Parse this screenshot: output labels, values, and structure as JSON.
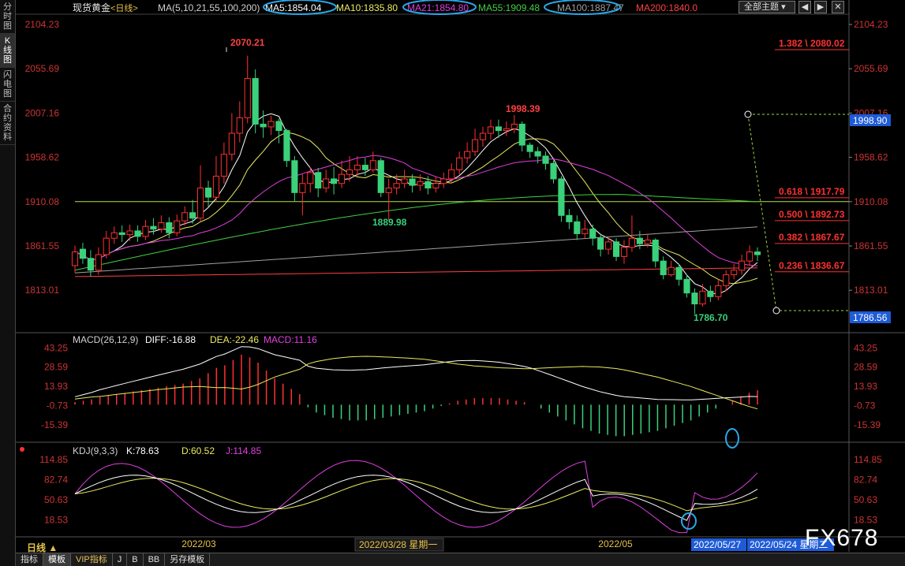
{
  "app": {
    "title": "现货黄金",
    "period_tag": "<日线>",
    "period_label": "日线 ▲",
    "watermark": "FX678",
    "theme_button": "全部主题",
    "theme_icon": "chevron-down-icon",
    "ctl_left": "◀",
    "ctl_right": "▶",
    "ctl_close": "✕"
  },
  "sidetabs": [
    {
      "label": "分时图"
    },
    {
      "label": "K线图",
      "active": true
    },
    {
      "label": "闪电图"
    },
    {
      "label": "合约资料"
    }
  ],
  "bottomtabs": [
    {
      "label": "指标"
    },
    {
      "label": "模板",
      "active": true
    },
    {
      "label": "VIP指标",
      "vip": true
    },
    {
      "label": "J"
    },
    {
      "label": "B"
    },
    {
      "label": "BB"
    },
    {
      "label": "另存模板"
    }
  ],
  "main": {
    "legend": [
      {
        "text": "MA(5,10,21,55,100,200)",
        "color": "#d0d0d0"
      },
      {
        "text": "MA5:1854.04",
        "color": "#ffffff"
      },
      {
        "text": "MA10:1835.80",
        "color": "#eaea60"
      },
      {
        "text": "MA21:1854.80",
        "color": "#e040e0"
      },
      {
        "text": "MA55:1909.48",
        "color": "#40d040"
      },
      {
        "text": "MA100:1887.47",
        "color": "#a0a0a0"
      },
      {
        "text": "MA200:1840.0",
        "color": "#ff4040"
      }
    ],
    "yticks": [
      "2104.23",
      "2055.69",
      "2007.16",
      "1958.62",
      "1910.08",
      "1861.55",
      "1813.01"
    ],
    "ymin": 1770,
    "ymax": 2112,
    "price_tags": [
      {
        "text": "1998.90",
        "value": 1998.9
      },
      {
        "text": "1786.56",
        "value": 1786.56
      }
    ],
    "annotations": [
      {
        "text": "2070.21",
        "value": 2070.21
      },
      {
        "text": "1998.39",
        "value": 1998.39
      },
      {
        "text": "1889.98",
        "value": 1889.98
      },
      {
        "text": "1786.70",
        "value": 1786.7
      }
    ],
    "fib": [
      {
        "text": "1.382 \\ 2080.02",
        "value": 2080.02
      },
      {
        "text": "0.618 \\ 1917.79",
        "value": 1917.79
      },
      {
        "text": "0.500 \\ 1892.73",
        "value": 1892.73
      },
      {
        "text": "0.382 \\ 1867.67",
        "value": 1867.67
      },
      {
        "text": "0.236 \\ 1836.67",
        "value": 1836.67
      }
    ],
    "hline": 1910.08
  },
  "macd": {
    "legend": [
      {
        "text": "MACD(26,12,9)",
        "color": "#d0d0d0"
      },
      {
        "text": "DIFF:-16.88",
        "color": "#ffffff"
      },
      {
        "text": "DEA:-22.46",
        "color": "#eaea60"
      },
      {
        "text": "MACD:11.16",
        "color": "#e040e0"
      }
    ],
    "yticks": [
      "43.25",
      "28.59",
      "13.93",
      "-0.73",
      "-15.39"
    ],
    "ymin": -25,
    "ymax": 47
  },
  "kdj": {
    "legend": [
      {
        "text": "KDJ(9,3,3)",
        "color": "#d0d0d0"
      },
      {
        "text": "K:78.63",
        "color": "#ffffff"
      },
      {
        "text": "D:60.52",
        "color": "#eaea60"
      },
      {
        "text": "J:114.85",
        "color": "#e040e0"
      }
    ],
    "yticks": [
      "114.85",
      "82.74",
      "50.63",
      "18.53"
    ],
    "ymin": -5,
    "ymax": 125
  },
  "xaxis": {
    "labels": [
      "2022/03",
      "2022/03/28 星期一",
      "2022/05"
    ],
    "cursor_dates": [
      "2022/05/27",
      "2022/05/24 星期二"
    ]
  },
  "chart_data": {
    "type": "candlestick",
    "title": "现货黄金<日线>",
    "x_labels": [
      "2022/03",
      "2022/05"
    ],
    "yrange": [
      1770,
      2112
    ],
    "candles": [
      [
        1840,
        1855,
        1862,
        1832
      ],
      [
        1858,
        1848,
        1865,
        1842
      ],
      [
        1848,
        1835,
        1857,
        1828
      ],
      [
        1835,
        1852,
        1860,
        1830
      ],
      [
        1852,
        1870,
        1878,
        1848
      ],
      [
        1870,
        1876,
        1883,
        1864
      ],
      [
        1876,
        1874,
        1884,
        1866
      ],
      [
        1874,
        1878,
        1885,
        1867
      ],
      [
        1878,
        1872,
        1884,
        1866
      ],
      [
        1872,
        1883,
        1890,
        1868
      ],
      [
        1883,
        1880,
        1892,
        1874
      ],
      [
        1880,
        1887,
        1895,
        1876
      ],
      [
        1887,
        1876,
        1893,
        1870
      ],
      [
        1876,
        1889,
        1896,
        1872
      ],
      [
        1889,
        1898,
        1905,
        1884
      ],
      [
        1898,
        1892,
        1912,
        1886
      ],
      [
        1892,
        1925,
        1950,
        1888
      ],
      [
        1925,
        1915,
        1933,
        1905
      ],
      [
        1915,
        1938,
        1960,
        1910
      ],
      [
        1938,
        1962,
        1975,
        1930
      ],
      [
        1962,
        1985,
        2007,
        1955
      ],
      [
        1985,
        2002,
        2020,
        1975
      ],
      [
        2002,
        2045,
        2070,
        1996
      ],
      [
        2045,
        1995,
        2055,
        1985
      ],
      [
        1995,
        1992,
        2010,
        1980
      ],
      [
        1992,
        1998,
        2004,
        1983
      ],
      [
        1998,
        1988,
        2001,
        1974
      ],
      [
        1988,
        1955,
        1990,
        1948
      ],
      [
        1955,
        1920,
        1960,
        1910
      ],
      [
        1920,
        1930,
        1940,
        1895
      ],
      [
        1930,
        1942,
        1948,
        1920
      ],
      [
        1942,
        1925,
        1947,
        1915
      ],
      [
        1925,
        1935,
        1945,
        1920
      ],
      [
        1935,
        1930,
        1948,
        1918
      ],
      [
        1930,
        1940,
        1955,
        1925
      ],
      [
        1940,
        1945,
        1960,
        1932
      ],
      [
        1945,
        1950,
        1960,
        1938
      ],
      [
        1950,
        1945,
        1958,
        1938
      ],
      [
        1945,
        1955,
        1965,
        1942
      ],
      [
        1955,
        1920,
        1958,
        1915
      ],
      [
        1920,
        1925,
        1935,
        1890
      ],
      [
        1925,
        1930,
        1940,
        1918
      ],
      [
        1930,
        1935,
        1945,
        1925
      ],
      [
        1935,
        1928,
        1940,
        1920
      ],
      [
        1928,
        1932,
        1940,
        1922
      ],
      [
        1932,
        1925,
        1938,
        1918
      ],
      [
        1925,
        1930,
        1938,
        1920
      ],
      [
        1930,
        1935,
        1942,
        1925
      ],
      [
        1935,
        1945,
        1952,
        1930
      ],
      [
        1945,
        1958,
        1965,
        1940
      ],
      [
        1958,
        1965,
        1975,
        1952
      ],
      [
        1965,
        1978,
        1990,
        1960
      ],
      [
        1978,
        1985,
        1992,
        1970
      ],
      [
        1985,
        1992,
        2000,
        1978
      ],
      [
        1992,
        1988,
        2000,
        1980
      ],
      [
        1988,
        1990,
        1998,
        1982
      ],
      [
        1990,
        1995,
        2005,
        1985
      ],
      [
        1995,
        1972,
        1998,
        1965
      ],
      [
        1972,
        1965,
        1975,
        1958
      ],
      [
        1965,
        1960,
        1970,
        1952
      ],
      [
        1960,
        1952,
        1965,
        1945
      ],
      [
        1952,
        1935,
        1955,
        1930
      ],
      [
        1935,
        1895,
        1938,
        1888
      ],
      [
        1895,
        1888,
        1902,
        1880
      ],
      [
        1888,
        1875,
        1895,
        1868
      ],
      [
        1875,
        1880,
        1890,
        1870
      ],
      [
        1880,
        1870,
        1885,
        1862
      ],
      [
        1870,
        1858,
        1875,
        1850
      ],
      [
        1858,
        1866,
        1872,
        1852
      ],
      [
        1866,
        1850,
        1870,
        1845
      ],
      [
        1850,
        1860,
        1868,
        1842
      ],
      [
        1860,
        1870,
        1895,
        1855
      ],
      [
        1870,
        1864,
        1878,
        1858
      ],
      [
        1864,
        1868,
        1875,
        1860
      ],
      [
        1868,
        1845,
        1870,
        1838
      ],
      [
        1845,
        1830,
        1850,
        1825
      ],
      [
        1830,
        1838,
        1845,
        1828
      ],
      [
        1838,
        1825,
        1842,
        1818
      ],
      [
        1825,
        1810,
        1830,
        1805
      ],
      [
        1810,
        1798,
        1815,
        1787
      ],
      [
        1798,
        1812,
        1820,
        1795
      ],
      [
        1812,
        1806,
        1818,
        1800
      ],
      [
        1806,
        1818,
        1825,
        1802
      ],
      [
        1818,
        1830,
        1835,
        1812
      ],
      [
        1830,
        1835,
        1842,
        1825
      ],
      [
        1835,
        1845,
        1852,
        1830
      ],
      [
        1845,
        1855,
        1862,
        1840
      ],
      [
        1855,
        1852,
        1860,
        1845
      ]
    ],
    "ma": [
      {
        "name": "MA5",
        "color": "#ffffff"
      },
      {
        "name": "MA10",
        "color": "#eaea60"
      },
      {
        "name": "MA21",
        "color": "#e040e0"
      },
      {
        "name": "MA55",
        "color": "#40d040"
      },
      {
        "name": "MA100",
        "color": "#a0a0a0"
      },
      {
        "name": "MA200",
        "color": "#ff4040"
      }
    ],
    "macd_hist": [
      2,
      3,
      4,
      6,
      7,
      8,
      9,
      10,
      11,
      12,
      13,
      14,
      15,
      16,
      18,
      20,
      24,
      28,
      30,
      34,
      38,
      36,
      32,
      26,
      20,
      16,
      12,
      8,
      -2,
      -6,
      -8,
      -10,
      -11,
      -12,
      -12,
      -12,
      -11,
      -10,
      -9,
      -8,
      -7,
      -6,
      -5,
      -3,
      -1,
      1,
      3,
      4,
      5,
      5,
      5,
      5,
      4,
      3,
      2,
      0,
      -3,
      -6,
      -9,
      -12,
      -15,
      -18,
      -20,
      -22,
      -23,
      -24,
      -24,
      -23,
      -22,
      -21,
      -20,
      -18,
      -16,
      -14,
      -12,
      -9,
      -6,
      -3,
      0,
      3,
      6,
      9,
      11
    ]
  }
}
